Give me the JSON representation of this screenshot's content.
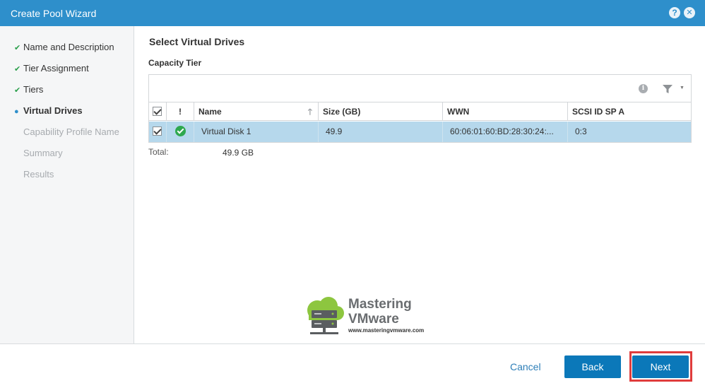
{
  "window": {
    "title": "Create Pool Wizard",
    "help_icon": "question-icon",
    "close_icon": "close-icon",
    "accent": "#2e8fcb"
  },
  "steps": [
    {
      "label": "Name and Description",
      "state": "done"
    },
    {
      "label": "Tier Assignment",
      "state": "done"
    },
    {
      "label": "Tiers",
      "state": "done"
    },
    {
      "label": "Virtual Drives",
      "state": "current"
    },
    {
      "label": "Capability Profile Name",
      "state": "future"
    },
    {
      "label": "Summary",
      "state": "future"
    },
    {
      "label": "Results",
      "state": "future"
    }
  ],
  "main": {
    "section_title": "Select Virtual Drives",
    "tier_title": "Capacity Tier",
    "columns": [
      "!",
      "Name",
      "Size (GB)",
      "WWN",
      "SCSI ID SP A"
    ],
    "rows": [
      {
        "selected": true,
        "status": "ok",
        "name": "Virtual Disk 1",
        "size": "49.9",
        "wwn": "60:06:01:60:BD:28:30:24:...",
        "scsi": "0:3"
      }
    ],
    "total_label": "Total:",
    "total_value": "49.9 GB"
  },
  "watermark": {
    "line1": "Mastering",
    "line2": "VMware",
    "url": "www.masteringvmware.com"
  },
  "footer": {
    "cancel": "Cancel",
    "back": "Back",
    "next": "Next",
    "highlight_color": "#e03c3c"
  }
}
